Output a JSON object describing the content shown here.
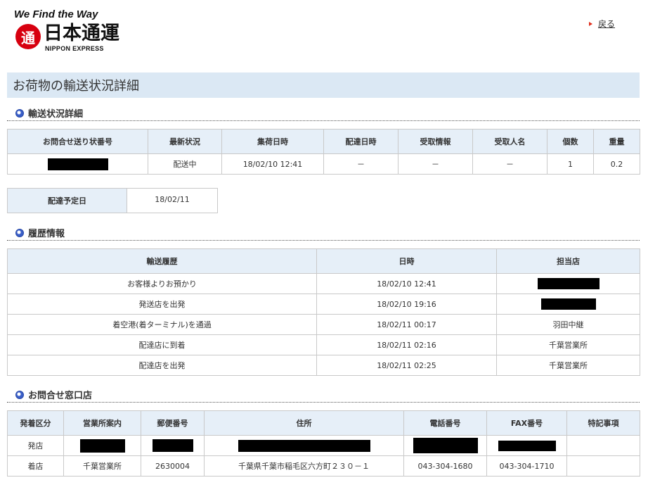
{
  "header": {
    "slogan": "We Find the Way",
    "logo_mark": "通",
    "company_name": "日本通運",
    "company_name_en": "NIPPON EXPRESS",
    "back_label": "戻る"
  },
  "page_title": "お荷物の輸送状況詳細",
  "status_section": {
    "title": "輸送状況詳細",
    "headers": [
      "お問合せ送り状番号",
      "最新状況",
      "集荷日時",
      "配達日時",
      "受取情報",
      "受取人名",
      "個数",
      "重量"
    ],
    "row": {
      "status": "配送中",
      "pickup": "18/02/10 12:41",
      "delivered": "－",
      "receipt": "－",
      "recipient": "－",
      "count": "1",
      "weight": "0.2"
    }
  },
  "planned_delivery": {
    "label": "配達予定日",
    "value": "18/02/11"
  },
  "history_section": {
    "title": "履歴情報",
    "headers": [
      "輸送履歴",
      "日時",
      "担当店"
    ],
    "rows": [
      {
        "event": "お客様よりお預かり",
        "datetime": "18/02/10 12:41",
        "office": ""
      },
      {
        "event": "発送店を出発",
        "datetime": "18/02/10 19:16",
        "office": ""
      },
      {
        "event": "着空港(着ターミナル)を通過",
        "datetime": "18/02/11 00:17",
        "office": "羽田中継"
      },
      {
        "event": "配達店に到着",
        "datetime": "18/02/11 02:16",
        "office": "千葉営業所"
      },
      {
        "event": "配達店を出発",
        "datetime": "18/02/11 02:25",
        "office": "千葉営業所"
      }
    ]
  },
  "contact_section": {
    "title": "お問合せ窓口店",
    "headers": [
      "発着区分",
      "営業所案内",
      "郵便番号",
      "住所",
      "電話番号",
      "FAX番号",
      "特記事項"
    ],
    "rows": [
      {
        "type": "発店",
        "office": "",
        "postal": "",
        "address": "",
        "tel": "",
        "fax": "",
        "notes": ""
      },
      {
        "type": "着店",
        "office": "千葉営業所",
        "postal": "2630004",
        "address": "千葉県千葉市稲毛区六方町２３０－１",
        "tel": "043-304-1680",
        "fax": "043-304-1710",
        "notes": ""
      }
    ]
  },
  "colors": {
    "title_bar": "#dbe8f4",
    "table_header": "#e6eff8",
    "logo_red": "#d7000f",
    "arrow_red": "#e0301e"
  }
}
